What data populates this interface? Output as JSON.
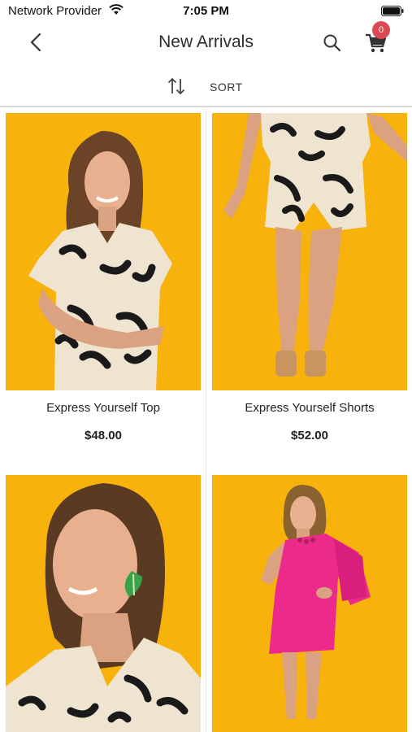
{
  "status_bar": {
    "carrier": "Network Provider",
    "time": "7:05 PM",
    "wifi_icon": "wifi-icon",
    "battery_icon": "battery-icon"
  },
  "nav": {
    "title": "New Arrivals",
    "back_icon": "chevron-left-icon",
    "search_icon": "search-icon",
    "cart_icon": "cart-icon",
    "cart_count": "0"
  },
  "sort": {
    "label": "SORT",
    "icon": "sort-arrows-icon"
  },
  "colors": {
    "background_image": "#f8b20c",
    "badge": "#d94a55",
    "divider": "#d9d9d9"
  },
  "products": [
    {
      "name": "Express Yourself Top",
      "price": "$48.00"
    },
    {
      "name": "Express Yourself Shorts",
      "price": "$52.00"
    },
    {
      "name": "",
      "price": ""
    },
    {
      "name": "",
      "price": ""
    }
  ]
}
